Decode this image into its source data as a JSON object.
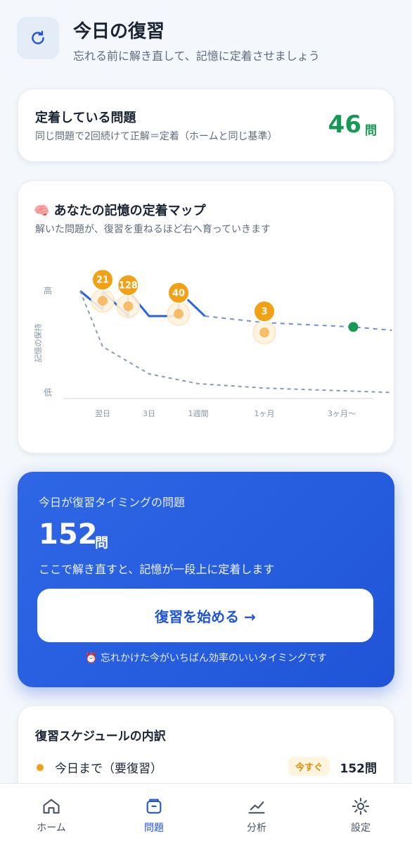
{
  "header": {
    "title": "今日の復習",
    "subtitle": "忘れる前に解き直して、記憶に定着させましょう",
    "icon": "refresh-icon"
  },
  "retained": {
    "title": "定着している問題",
    "subtitle": "同じ問題で2回続けて正解＝定着（ホームと同じ基準）",
    "count": "46",
    "unit": "問",
    "color": "#149a55"
  },
  "memory_map": {
    "title": "🧠 あなたの記憶の定着マップ",
    "subtitle": "解いた問題が、復習を重ねるほど右へ育っていきます"
  },
  "chart_data": {
    "type": "line",
    "ylabel": "記憶の保持",
    "y_ticks": [
      "高",
      "低"
    ],
    "x_ticks": [
      "翌日",
      "3日",
      "1週間",
      "1ヶ月",
      "3ヶ月〜"
    ],
    "x_positions": [
      0,
      1,
      2,
      3,
      4
    ],
    "series": [
      {
        "style": "solid",
        "color": "#2a63e0",
        "points": [
          [
            -0.5,
            0.96
          ],
          [
            0,
            0.79
          ],
          [
            0,
            0.96
          ],
          [
            0.55,
            0.73
          ],
          [
            0.55,
            0.96
          ],
          [
            1,
            0.73
          ],
          [
            1.6,
            0.73
          ],
          [
            1.6,
            0.96
          ],
          [
            2.1,
            0.73
          ]
        ]
      },
      {
        "style": "dashed",
        "color": "#6f8fdf",
        "points": [
          [
            2.1,
            0.73
          ],
          [
            3,
            0.67
          ],
          [
            4.15,
            0.63
          ],
          [
            4.65,
            0.6
          ]
        ]
      },
      {
        "style": "dashed",
        "color": "#8a9ab3",
        "points": [
          [
            -0.5,
            0.96
          ],
          [
            0,
            0.45
          ],
          [
            1,
            0.2
          ],
          [
            2,
            0.11
          ],
          [
            3,
            0.07
          ],
          [
            4.65,
            0.03
          ]
        ]
      }
    ],
    "bubbles": [
      {
        "label": "21",
        "x": 0,
        "y": 0.96
      },
      {
        "label": "128",
        "x": 0.55,
        "y": 0.91
      },
      {
        "label": "40",
        "x": 1.6,
        "y": 0.84
      },
      {
        "label": "3",
        "x": 3,
        "y": 0.67
      }
    ],
    "goal_point": {
      "x": 4.15,
      "y": 0.63,
      "color": "#149a55"
    },
    "bubble_color": "#f2a014"
  },
  "review": {
    "label": "今日が復習タイミングの問題",
    "count": "152",
    "unit": "問",
    "description": "ここで解き直すと、記憶が一段上に定着します",
    "button_label": "復習を始める →",
    "hint": "⏰ 忘れかけた今がいちばん効率のいいタイミングです",
    "accent": "#2054d8"
  },
  "schedule": {
    "title": "復習スケジュールの内訳",
    "rows": [
      {
        "label": "今日まで（要復習）",
        "badge": "今すぐ",
        "value": "152問"
      }
    ]
  },
  "tabs": [
    {
      "label": "ホーム",
      "icon": "home-icon",
      "active": false
    },
    {
      "label": "問題",
      "icon": "question-box-icon",
      "active": true
    },
    {
      "label": "分析",
      "icon": "chart-icon",
      "active": false
    },
    {
      "label": "設定",
      "icon": "gear-icon",
      "active": false
    }
  ]
}
